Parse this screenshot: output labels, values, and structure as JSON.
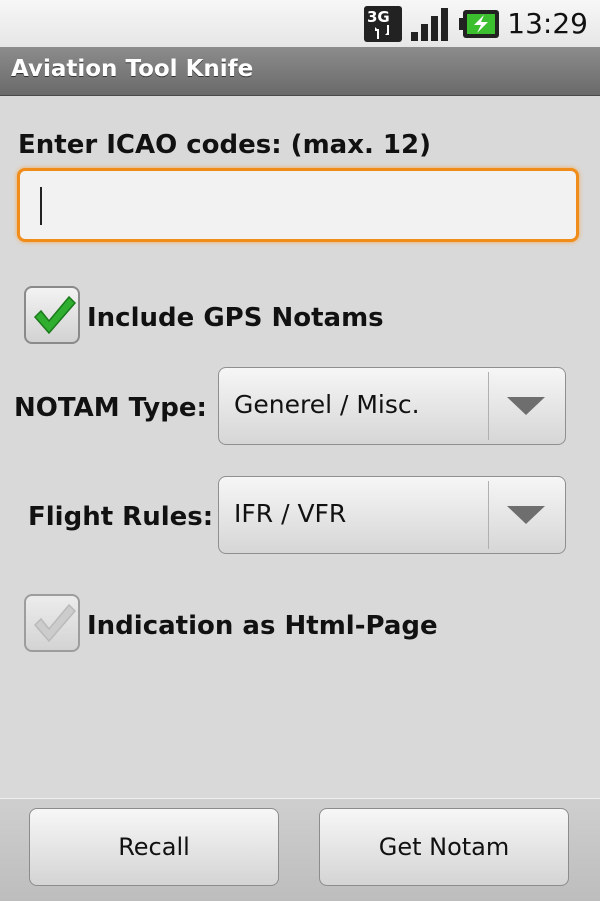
{
  "status_bar": {
    "network": "3G",
    "time": "13:29",
    "icons": [
      "network-3g-icon",
      "signal-strength-icon",
      "battery-charging-icon"
    ]
  },
  "app": {
    "title": "Aviation Tool Knife"
  },
  "form": {
    "icao_label": "Enter ICAO codes: (max. 12)",
    "icao_value": "",
    "gps_notams": {
      "label": "Include GPS Notams",
      "checked": true
    },
    "notam_type": {
      "label": "NOTAM Type:",
      "selected": "Generel / Misc."
    },
    "flight_rules": {
      "label": "Flight Rules:",
      "selected": "IFR / VFR"
    },
    "html_page": {
      "label": "Indication as Html-Page",
      "checked": false,
      "enabled": false
    }
  },
  "buttons": {
    "recall": "Recall",
    "get_notam": "Get Notam"
  },
  "colors": {
    "input_focus": "#f08c1a",
    "check_green": "#2fae2f"
  }
}
